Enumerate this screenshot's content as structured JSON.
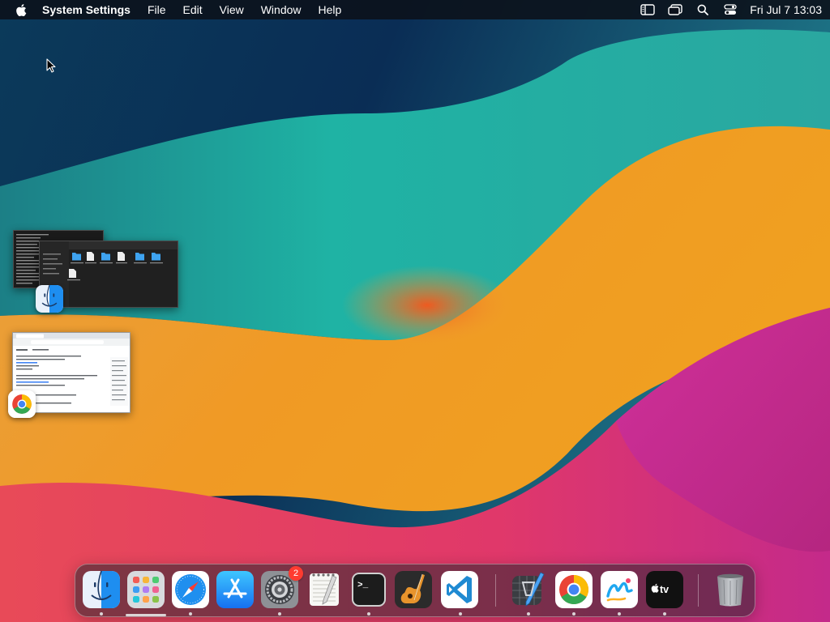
{
  "menubar": {
    "app_name": "System Settings",
    "menus": [
      "File",
      "Edit",
      "View",
      "Window",
      "Help"
    ],
    "clock": "Fri Jul 7  13:03"
  },
  "stage_manager": {
    "groups": [
      "Finder",
      "Google Chrome"
    ]
  },
  "dock": {
    "system_settings_badge": "2",
    "apps": [
      "Finder",
      "Launchpad",
      "Safari",
      "App Store",
      "System Settings",
      "TextEdit",
      "Terminal",
      "GarageBand",
      "Visual Studio Code",
      "Xcode",
      "Google Chrome",
      "Freeform",
      "Apple TV",
      "Trash"
    ]
  },
  "colors": {
    "badge": "#ff3b30",
    "chrome_red": "#ea4335",
    "chrome_yellow": "#fbbc05",
    "chrome_green": "#34a853",
    "chrome_blue": "#4285f4",
    "vscode_blue": "#1f8ad2"
  }
}
